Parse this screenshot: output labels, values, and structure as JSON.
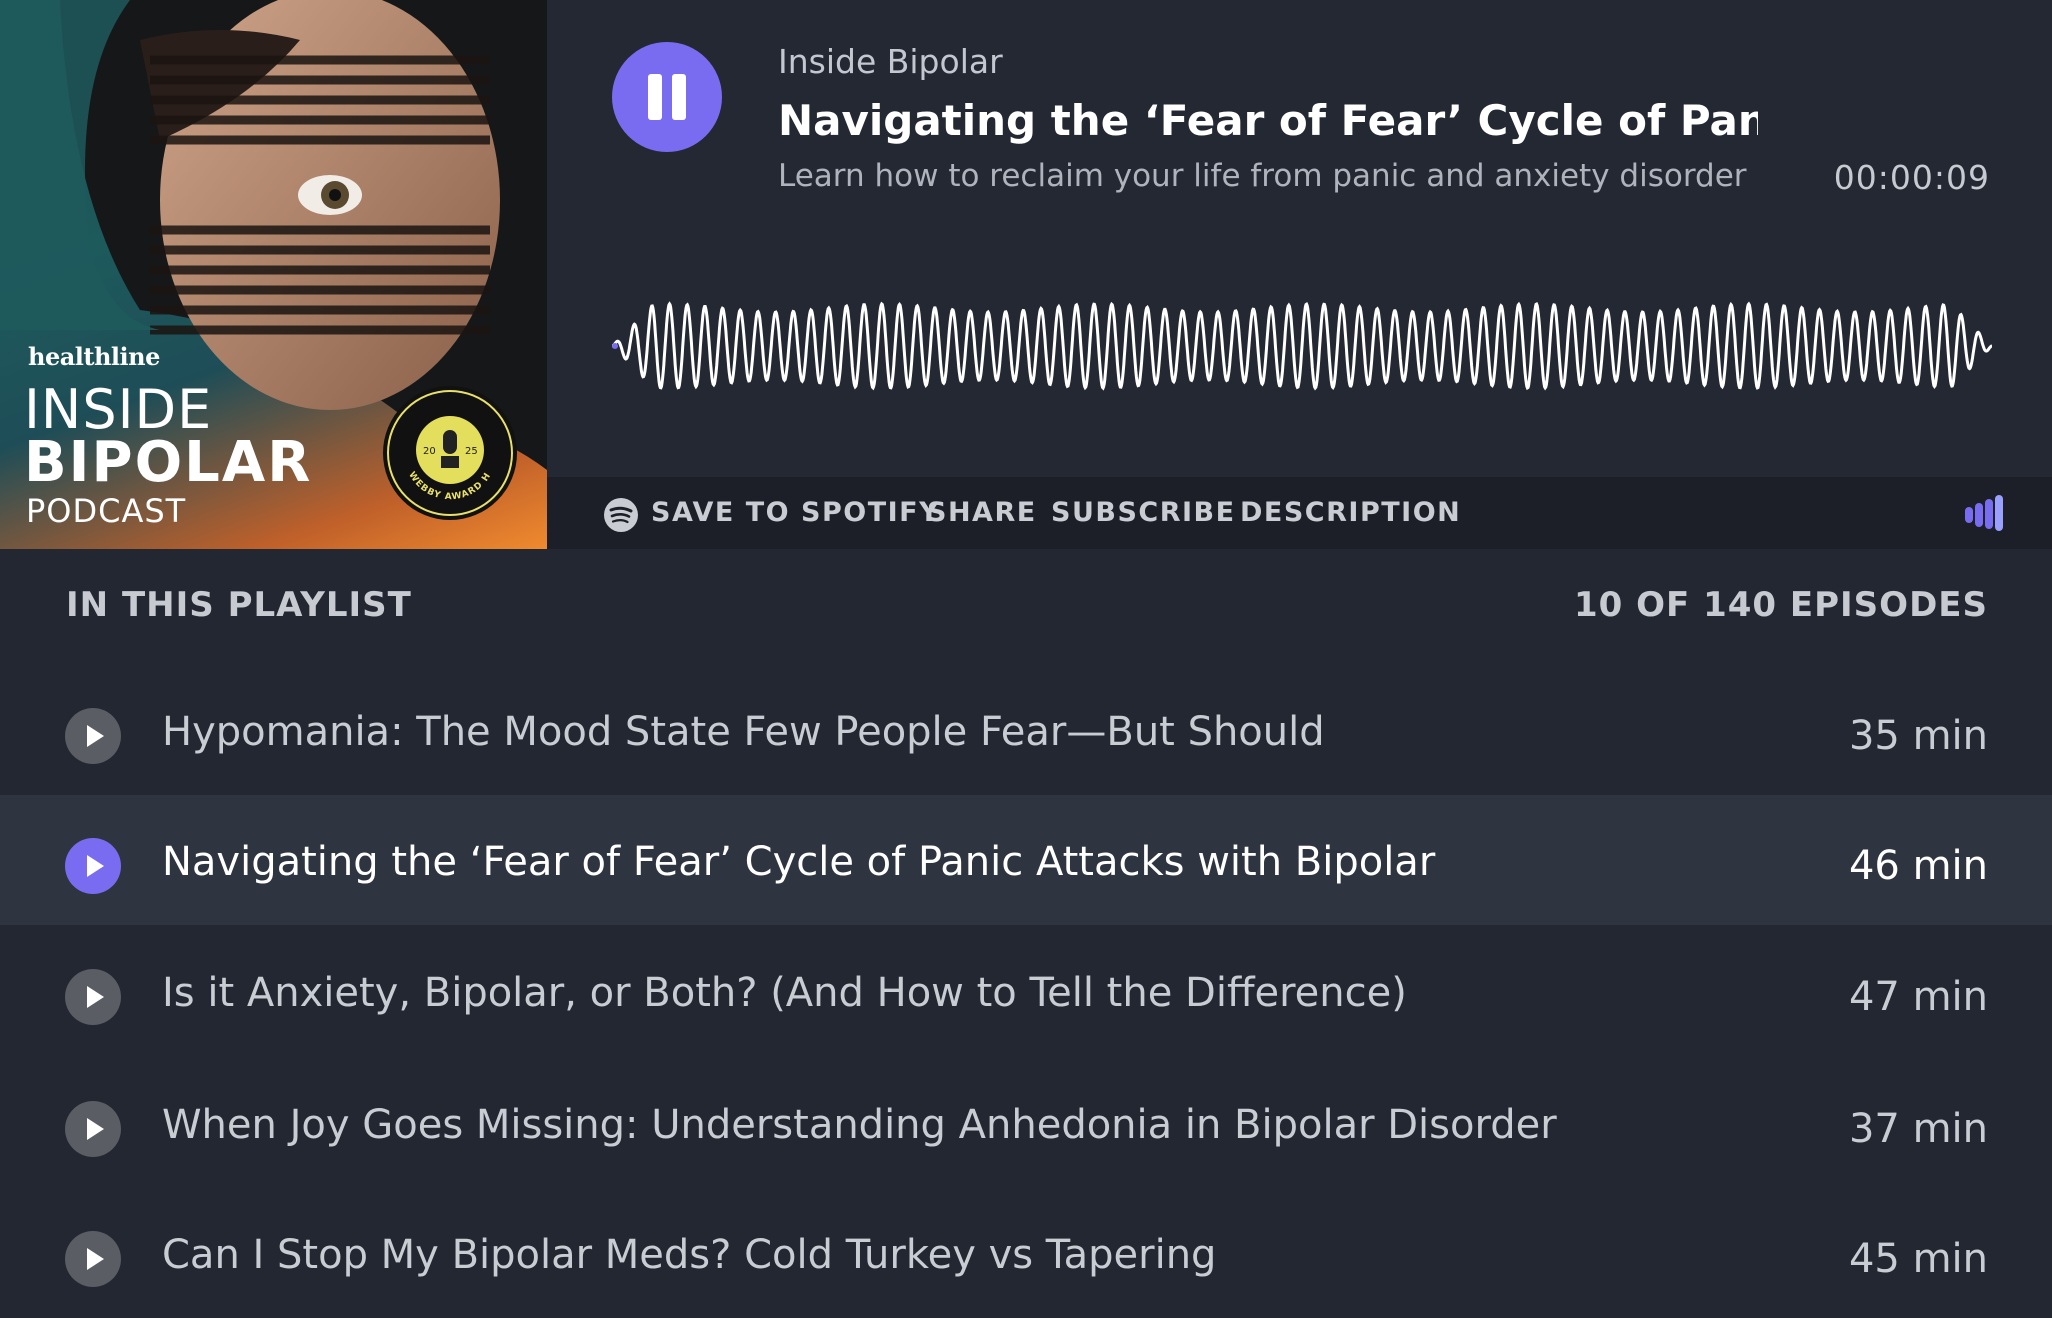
{
  "cover": {
    "brand": "healthline",
    "title_line1": "INSIDE",
    "title_line2": "BIPOLAR",
    "title_line3": "PODCAST",
    "badge_text": "WEBBY AWARD HONOREE",
    "badge_year": "2025"
  },
  "player": {
    "podcast_name": "Inside Bipolar",
    "episode_title": "Navigating the ‘Fear of Fear’ Cycle of Panic ...",
    "episode_description": "Learn how to reclaim your life from panic and anxiety disorder",
    "elapsed_time": "00:00:09",
    "state_icon": "pause-icon",
    "accent_color": "#7a6cf0"
  },
  "toolbar": {
    "save_label": "SAVE TO SPOTIFY",
    "share_label": "SHARE",
    "subscribe_label": "SUBSCRIBE",
    "description_label": "DESCRIPTION"
  },
  "playlist": {
    "heading": "IN THIS PLAYLIST",
    "count": "10 OF 140 EPISODES",
    "episodes": [
      {
        "title": "Hypomania: The Mood State Few People Fear—But Should",
        "duration": "35 min",
        "active": false
      },
      {
        "title": "Navigating the ‘Fear of Fear’ Cycle of Panic Attacks with Bipolar",
        "duration": "46 min",
        "active": true
      },
      {
        "title": "Is it Anxiety, Bipolar, or Both? (And How to Tell the Difference)",
        "duration": "47 min",
        "active": false
      },
      {
        "title": "When Joy Goes Missing: Understanding Anhedonia in Bipolar Disorder",
        "duration": "37 min",
        "active": false
      },
      {
        "title": "Can I Stop My Bipolar Meds?  Cold Turkey vs Tapering",
        "duration": "45 min",
        "active": false
      }
    ]
  }
}
